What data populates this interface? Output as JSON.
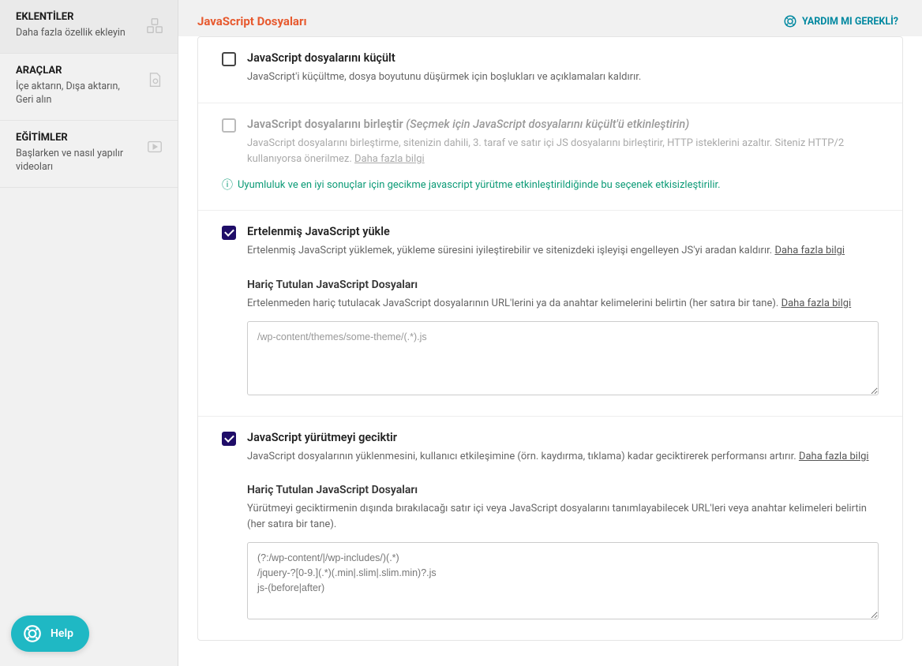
{
  "sidebar": {
    "items": [
      {
        "title": "EKLENTİLER",
        "desc": "Daha fazla özellik ekleyin"
      },
      {
        "title": "ARAÇLAR",
        "desc": "İçe aktarın, Dışa aktarın, Geri alın"
      },
      {
        "title": "EĞİTİMLER",
        "desc": "Başlarken ve nasıl yapılır videoları"
      }
    ]
  },
  "header": {
    "title": "JavaScript Dosyaları",
    "help": "YARDIM MI GEREKLİ?"
  },
  "options": {
    "minify": {
      "title": "JavaScript dosyalarını küçült",
      "desc": "JavaScript'i küçültme, dosya boyutunu düşürmek için boşlukları ve açıklamaları kaldırır."
    },
    "combine": {
      "title": "JavaScript dosyalarını birleştir",
      "cond": "(Seçmek için JavaScript dosyalarını küçült'ü etkinleştirin)",
      "desc": "JavaScript dosyalarını birleştirme, sitenizin dahili, 3. taraf ve satır içi JS dosyalarını birleştirir, HTTP isteklerini azaltır. Siteniz HTTP/2 kullanıyorsa önerilmez.",
      "more": "Daha fazla bilgi",
      "note": "Uyumluluk ve en iyi sonuçlar için gecikme javascript yürütme etkinleştirildiğinde bu seçenek etkisizleştirilir."
    },
    "defer": {
      "title": "Ertelenmiş JavaScript yükle",
      "desc": "Ertelenmiş JavaScript yüklemek, yükleme süresini iyileştirebilir ve sitenizdeki işleyişi engelleyen JS'yi aradan kaldırır.",
      "more": "Daha fazla bilgi",
      "exclude_title": "Hariç Tutulan JavaScript Dosyaları",
      "exclude_desc": "Ertelenmeden hariç tutulacak JavaScript dosyalarının URL'lerini ya da anahtar kelimelerini belirtin (her satıra bir tane).",
      "exclude_more": "Daha fazla bilgi",
      "exclude_placeholder": "/wp-content/themes/some-theme/(.*).js"
    },
    "delay": {
      "title": "JavaScript yürütmeyi geciktir",
      "desc": "JavaScript dosyalarının yüklenmesini, kullanıcı etkileşimine (örn. kaydırma, tıklama) kadar geciktirerek performansı artırır.",
      "more": "Daha fazla bilgi",
      "exclude_title": "Hariç Tutulan JavaScript Dosyaları",
      "exclude_desc": "Yürütmeyi geciktirmenin dışında bırakılacağı satır içi veya JavaScript dosyalarını tanımlayabilecek URL'leri veya anahtar kelimeleri belirtin (her satıra bir tane).",
      "exclude_value": "(?:/wp-content/|/wp-includes/)(.*)\n/jquery-?[0-9.](.*)(.min|.slim|.slim.min)?.js\njs-(before|after)"
    }
  },
  "help_widget": {
    "label": "Help"
  }
}
